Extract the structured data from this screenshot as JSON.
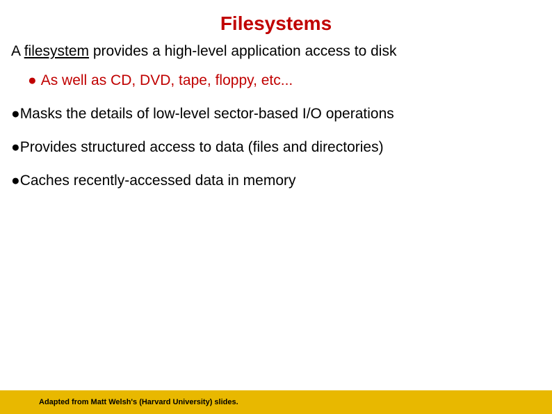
{
  "title": "Filesystems",
  "intro_prefix": "A ",
  "intro_underlined": "filesystem",
  "intro_suffix": " provides a high-level application access to disk",
  "sub_bullet": "As well as CD, DVD, tape, floppy, etc...",
  "bullet1": "Masks the details of low-level sector-based I/O operations",
  "bullet2": "Provides structured access to data  (files and directories)",
  "bullet3": "Caches recently-accessed data in memory",
  "footer": "Adapted from Matt Welsh's (Harvard University) slides."
}
